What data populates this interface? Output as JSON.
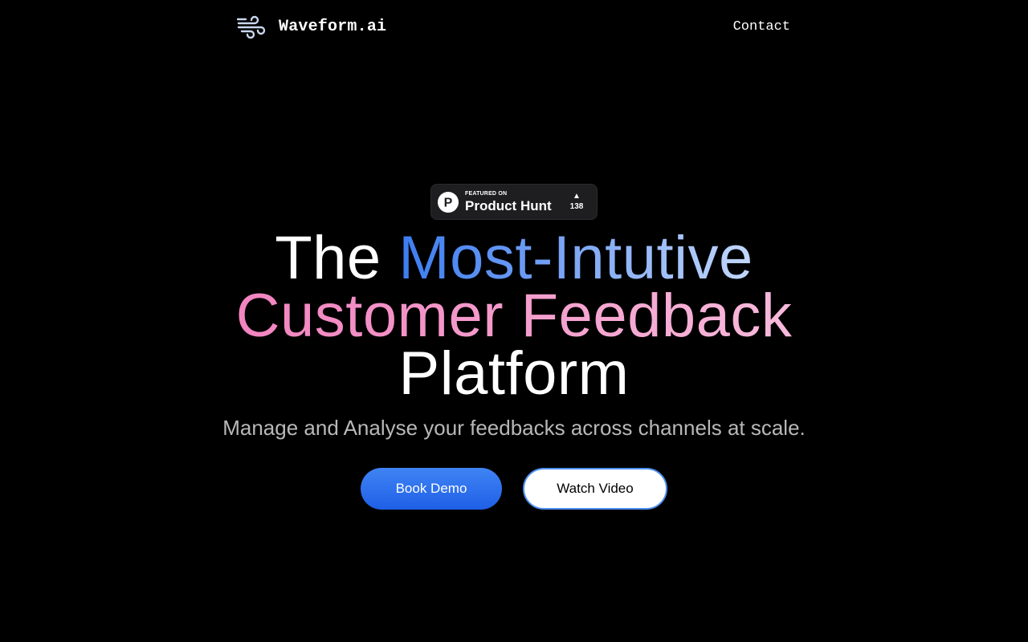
{
  "header": {
    "brand_name": "Waveform.ai",
    "brand_icon": "wind-icon",
    "nav": {
      "contact_label": "Contact"
    }
  },
  "badge": {
    "small_text": "FEATURED ON",
    "title": "Product Hunt",
    "logo_letter": "P",
    "upvote_icon": "triangle-up-icon",
    "votes": "138"
  },
  "hero": {
    "headline": {
      "line1_plain": "The ",
      "line1_highlight": "Most-Intutive",
      "line2": "Customer Feedback",
      "line3": "Platform"
    },
    "subtitle": "Manage and Analyse your feedbacks across channels at scale.",
    "cta_primary": "Book Demo",
    "cta_secondary": "Watch Video"
  },
  "colors": {
    "background": "#000000",
    "accent_blue": "#3b7cf0",
    "accent_pink": "#f06fb6",
    "badge_bg": "#1e1e20",
    "subtitle_gray": "#b8b8b8"
  }
}
